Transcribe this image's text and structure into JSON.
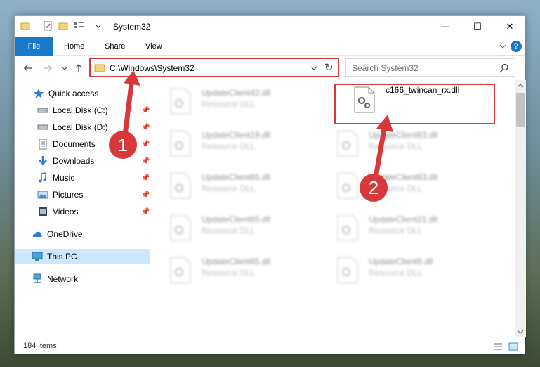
{
  "window": {
    "title": "System32",
    "minimize_glyph": "—",
    "maximize_glyph": "☐",
    "close_glyph": "✕"
  },
  "ribbon": {
    "tabs": [
      "File",
      "Home",
      "Share",
      "View"
    ],
    "help_glyph": "?"
  },
  "address_bar": {
    "path": "C:\\Windows\\System32",
    "refresh_glyph": "↻"
  },
  "search": {
    "placeholder": "Search System32"
  },
  "nav_pane": {
    "items": [
      {
        "label": "Quick access",
        "icon": "star-icon",
        "pinned": false
      },
      {
        "label": "Local Disk (C:)",
        "icon": "drive-icon",
        "pinned": true
      },
      {
        "label": "Local Disk (D:)",
        "icon": "drive-icon",
        "pinned": true
      },
      {
        "label": "Documents",
        "icon": "documents-icon",
        "pinned": true
      },
      {
        "label": "Downloads",
        "icon": "downloads-icon",
        "pinned": true
      },
      {
        "label": "Music",
        "icon": "music-icon",
        "pinned": true
      },
      {
        "label": "Pictures",
        "icon": "pictures-icon",
        "pinned": true
      },
      {
        "label": "Videos",
        "icon": "videos-icon",
        "pinned": true
      },
      {
        "label": "OneDrive",
        "icon": "onedrive-icon",
        "pinned": false
      },
      {
        "label": "This PC",
        "icon": "this-pc-icon",
        "pinned": false,
        "selected": true
      },
      {
        "label": "Network",
        "icon": "network-icon",
        "pinned": false
      }
    ]
  },
  "files": [
    {
      "name": "UpdateClient42.dll",
      "type": "Resource DLL",
      "blurred": true
    },
    {
      "name": "c166_twincan_rx.dll",
      "type": "",
      "blurred": false,
      "highlighted": true
    },
    {
      "name": "UpdateClient19.dll",
      "type": "Resource DLL",
      "blurred": true
    },
    {
      "name": "UpdateClient63.dll",
      "type": "Resource DLL",
      "blurred": true
    },
    {
      "name": "UpdateClient65.dll",
      "type": "Resource DLL",
      "blurred": true
    },
    {
      "name": "UpdateClient63.dll",
      "type": "Resource DLL",
      "blurred": true
    },
    {
      "name": "UpdateClient65.dll",
      "type": "Resource DLL",
      "blurred": true
    },
    {
      "name": "UpdateClient21.dll",
      "type": "Resource DLL",
      "blurred": true
    },
    {
      "name": "UpdateClient65.dll",
      "type": "Resource DLL",
      "blurred": true
    },
    {
      "name": "UpdateClient5.dll",
      "type": "Resource DLL",
      "blurred": true
    }
  ],
  "status_bar": {
    "item_count": "184 items"
  },
  "callouts": [
    "1",
    "2"
  ],
  "colors": {
    "accent": "#1979ca",
    "highlight_red": "#d9383a",
    "selected_bg": "#cce8ff"
  }
}
